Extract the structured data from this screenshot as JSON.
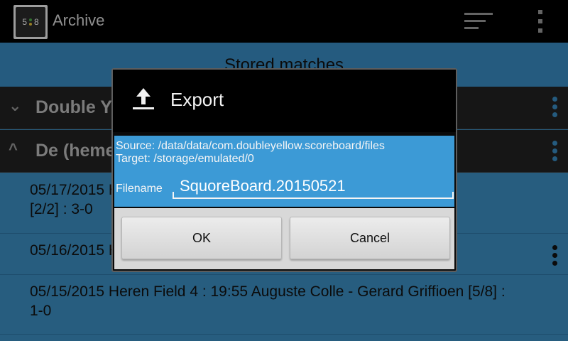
{
  "app": {
    "icon_text_left": "5",
    "icon_text_right": "8",
    "title": "Archive"
  },
  "section": {
    "title": "Stored matches"
  },
  "groups": [
    {
      "chevron": "⌄",
      "title": "Double Yellow Boxen"
    },
    {
      "chevron": "^",
      "title": "De (heme"
    }
  ],
  "matches": [
    {
      "line1": "05/17/2015 Heren Field 1 : 13:00 Kurt De Maeyer",
      "line2": "[2/2] : 3-0"
    },
    {
      "line1": "05/16/2015 Heren Field 2 : 14:00 Jan Van Pelt : 3-0",
      "line2": ""
    },
    {
      "line1": "05/15/2015 Heren Field 4 : 19:55 Auguste Colle - Gerard Griffioen [5/8] :",
      "line2": "1-0"
    }
  ],
  "dialog": {
    "title": "Export",
    "icon": "upload-icon",
    "source": "Source: /data/data/com.doubleyellow.scoreboard/files",
    "target": "Target: /storage/emulated/0",
    "filename_label": "Filename",
    "filename_value": "SquoreBoard.20150521",
    "ok_label": "OK",
    "cancel_label": "Cancel"
  },
  "colors": {
    "accent": "#3a8dc3",
    "dialog_body": "#3c9ad6",
    "actionbar": "#000000"
  }
}
